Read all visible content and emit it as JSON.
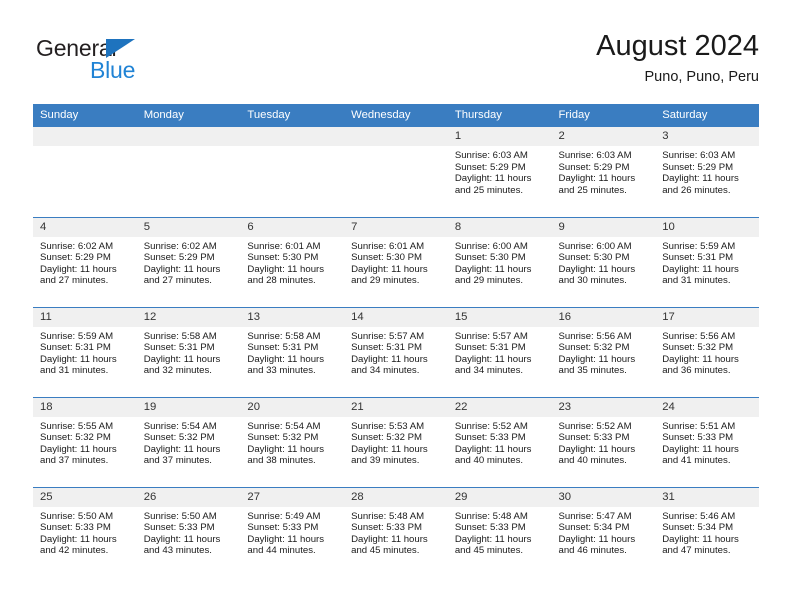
{
  "brand": {
    "name_top": "General",
    "name_bottom": "Blue",
    "triangle_color": "#1e73be",
    "blue_text_color": "#2083d5"
  },
  "header": {
    "title": "August 2024",
    "subtitle": "Puno, Puno, Peru"
  },
  "theme": {
    "header_bg": "#3a7dc1",
    "header_text": "#ffffff",
    "daynum_bg": "#f0f0f0",
    "row_divider": "#3a7dc1"
  },
  "weekdays": [
    "Sunday",
    "Monday",
    "Tuesday",
    "Wednesday",
    "Thursday",
    "Friday",
    "Saturday"
  ],
  "weeks": [
    [
      {
        "day": "",
        "sunrise": "",
        "sunset": "",
        "daylight": "",
        "empty": true
      },
      {
        "day": "",
        "sunrise": "",
        "sunset": "",
        "daylight": "",
        "empty": true
      },
      {
        "day": "",
        "sunrise": "",
        "sunset": "",
        "daylight": "",
        "empty": true
      },
      {
        "day": "",
        "sunrise": "",
        "sunset": "",
        "daylight": "",
        "empty": true
      },
      {
        "day": "1",
        "sunrise": "Sunrise: 6:03 AM",
        "sunset": "Sunset: 5:29 PM",
        "daylight": "Daylight: 11 hours and 25 minutes."
      },
      {
        "day": "2",
        "sunrise": "Sunrise: 6:03 AM",
        "sunset": "Sunset: 5:29 PM",
        "daylight": "Daylight: 11 hours and 25 minutes."
      },
      {
        "day": "3",
        "sunrise": "Sunrise: 6:03 AM",
        "sunset": "Sunset: 5:29 PM",
        "daylight": "Daylight: 11 hours and 26 minutes."
      }
    ],
    [
      {
        "day": "4",
        "sunrise": "Sunrise: 6:02 AM",
        "sunset": "Sunset: 5:29 PM",
        "daylight": "Daylight: 11 hours and 27 minutes."
      },
      {
        "day": "5",
        "sunrise": "Sunrise: 6:02 AM",
        "sunset": "Sunset: 5:29 PM",
        "daylight": "Daylight: 11 hours and 27 minutes."
      },
      {
        "day": "6",
        "sunrise": "Sunrise: 6:01 AM",
        "sunset": "Sunset: 5:30 PM",
        "daylight": "Daylight: 11 hours and 28 minutes."
      },
      {
        "day": "7",
        "sunrise": "Sunrise: 6:01 AM",
        "sunset": "Sunset: 5:30 PM",
        "daylight": "Daylight: 11 hours and 29 minutes."
      },
      {
        "day": "8",
        "sunrise": "Sunrise: 6:00 AM",
        "sunset": "Sunset: 5:30 PM",
        "daylight": "Daylight: 11 hours and 29 minutes."
      },
      {
        "day": "9",
        "sunrise": "Sunrise: 6:00 AM",
        "sunset": "Sunset: 5:30 PM",
        "daylight": "Daylight: 11 hours and 30 minutes."
      },
      {
        "day": "10",
        "sunrise": "Sunrise: 5:59 AM",
        "sunset": "Sunset: 5:31 PM",
        "daylight": "Daylight: 11 hours and 31 minutes."
      }
    ],
    [
      {
        "day": "11",
        "sunrise": "Sunrise: 5:59 AM",
        "sunset": "Sunset: 5:31 PM",
        "daylight": "Daylight: 11 hours and 31 minutes."
      },
      {
        "day": "12",
        "sunrise": "Sunrise: 5:58 AM",
        "sunset": "Sunset: 5:31 PM",
        "daylight": "Daylight: 11 hours and 32 minutes."
      },
      {
        "day": "13",
        "sunrise": "Sunrise: 5:58 AM",
        "sunset": "Sunset: 5:31 PM",
        "daylight": "Daylight: 11 hours and 33 minutes."
      },
      {
        "day": "14",
        "sunrise": "Sunrise: 5:57 AM",
        "sunset": "Sunset: 5:31 PM",
        "daylight": "Daylight: 11 hours and 34 minutes."
      },
      {
        "day": "15",
        "sunrise": "Sunrise: 5:57 AM",
        "sunset": "Sunset: 5:31 PM",
        "daylight": "Daylight: 11 hours and 34 minutes."
      },
      {
        "day": "16",
        "sunrise": "Sunrise: 5:56 AM",
        "sunset": "Sunset: 5:32 PM",
        "daylight": "Daylight: 11 hours and 35 minutes."
      },
      {
        "day": "17",
        "sunrise": "Sunrise: 5:56 AM",
        "sunset": "Sunset: 5:32 PM",
        "daylight": "Daylight: 11 hours and 36 minutes."
      }
    ],
    [
      {
        "day": "18",
        "sunrise": "Sunrise: 5:55 AM",
        "sunset": "Sunset: 5:32 PM",
        "daylight": "Daylight: 11 hours and 37 minutes."
      },
      {
        "day": "19",
        "sunrise": "Sunrise: 5:54 AM",
        "sunset": "Sunset: 5:32 PM",
        "daylight": "Daylight: 11 hours and 37 minutes."
      },
      {
        "day": "20",
        "sunrise": "Sunrise: 5:54 AM",
        "sunset": "Sunset: 5:32 PM",
        "daylight": "Daylight: 11 hours and 38 minutes."
      },
      {
        "day": "21",
        "sunrise": "Sunrise: 5:53 AM",
        "sunset": "Sunset: 5:32 PM",
        "daylight": "Daylight: 11 hours and 39 minutes."
      },
      {
        "day": "22",
        "sunrise": "Sunrise: 5:52 AM",
        "sunset": "Sunset: 5:33 PM",
        "daylight": "Daylight: 11 hours and 40 minutes."
      },
      {
        "day": "23",
        "sunrise": "Sunrise: 5:52 AM",
        "sunset": "Sunset: 5:33 PM",
        "daylight": "Daylight: 11 hours and 40 minutes."
      },
      {
        "day": "24",
        "sunrise": "Sunrise: 5:51 AM",
        "sunset": "Sunset: 5:33 PM",
        "daylight": "Daylight: 11 hours and 41 minutes."
      }
    ],
    [
      {
        "day": "25",
        "sunrise": "Sunrise: 5:50 AM",
        "sunset": "Sunset: 5:33 PM",
        "daylight": "Daylight: 11 hours and 42 minutes."
      },
      {
        "day": "26",
        "sunrise": "Sunrise: 5:50 AM",
        "sunset": "Sunset: 5:33 PM",
        "daylight": "Daylight: 11 hours and 43 minutes."
      },
      {
        "day": "27",
        "sunrise": "Sunrise: 5:49 AM",
        "sunset": "Sunset: 5:33 PM",
        "daylight": "Daylight: 11 hours and 44 minutes."
      },
      {
        "day": "28",
        "sunrise": "Sunrise: 5:48 AM",
        "sunset": "Sunset: 5:33 PM",
        "daylight": "Daylight: 11 hours and 45 minutes."
      },
      {
        "day": "29",
        "sunrise": "Sunrise: 5:48 AM",
        "sunset": "Sunset: 5:33 PM",
        "daylight": "Daylight: 11 hours and 45 minutes."
      },
      {
        "day": "30",
        "sunrise": "Sunrise: 5:47 AM",
        "sunset": "Sunset: 5:34 PM",
        "daylight": "Daylight: 11 hours and 46 minutes."
      },
      {
        "day": "31",
        "sunrise": "Sunrise: 5:46 AM",
        "sunset": "Sunset: 5:34 PM",
        "daylight": "Daylight: 11 hours and 47 minutes."
      }
    ]
  ]
}
